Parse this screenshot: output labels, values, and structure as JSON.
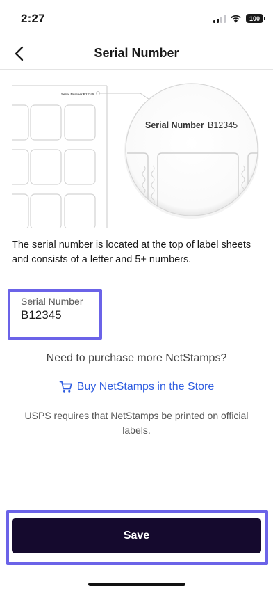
{
  "status_bar": {
    "time": "2:27",
    "battery": "100",
    "icons": [
      "signal-icon",
      "wifi-icon",
      "battery-icon"
    ]
  },
  "nav": {
    "title": "Serial Number",
    "back_icon": "chevron-left-icon"
  },
  "illustration": {
    "sheet_caption": "Serial Number B12345",
    "zoom_label": "Serial Number",
    "zoom_value": "B12345"
  },
  "description": "The serial number is located at the top of label sheets and consists of a letter and 5+ numbers.",
  "serial_field": {
    "label": "Serial Number",
    "value": "B12345"
  },
  "purchase_question": "Need to purchase more NetStamps?",
  "store_link": {
    "label": "Buy NetStamps in the Store",
    "icon": "cart-icon"
  },
  "usps_note": "USPS requires that NetStamps be printed on official labels.",
  "save_label": "Save",
  "colors": {
    "accent_link": "#2f5de0",
    "button_bg": "#150a2e",
    "highlight": "#6b63e8"
  }
}
